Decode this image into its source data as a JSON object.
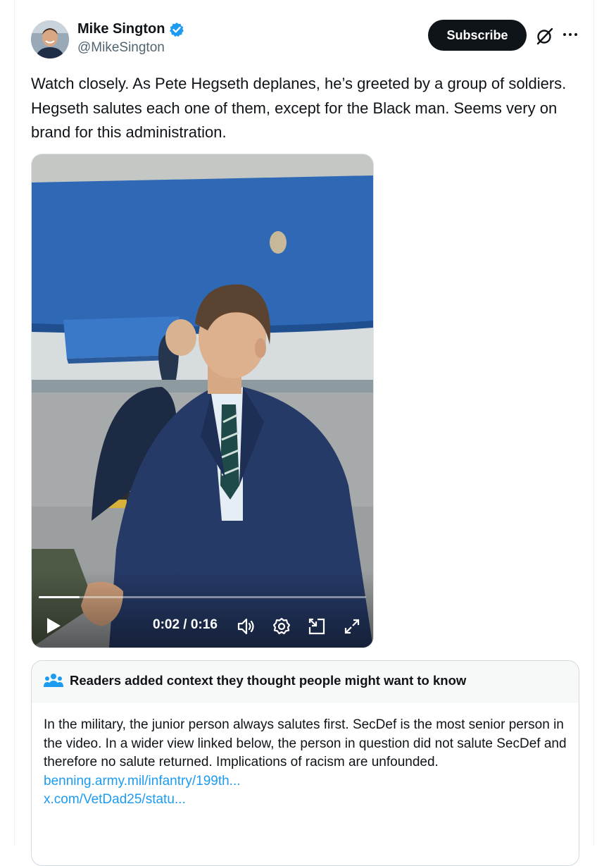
{
  "author": {
    "name": "Mike Sington",
    "handle": "@MikeSington",
    "verified": true,
    "verified_color": "#1d9bf0"
  },
  "actions": {
    "subscribe_label": "Subscribe",
    "grok_icon": "grok-icon",
    "more_icon": "more-horizontal-icon"
  },
  "tweet": {
    "text": "Watch closely. As Pete Hegseth deplanes, he’s greeted by a group of soldiers. Hegseth salutes each one of them, except for the Black man. Seems very on brand for this administration."
  },
  "video": {
    "current_time": "0:02",
    "duration": "0:16",
    "time_display": "0:02 / 0:16",
    "progress": 0.125,
    "controls": [
      "play-icon",
      "volume-icon",
      "settings-icon",
      "picture-in-picture-icon",
      "fullscreen-icon"
    ]
  },
  "community_note": {
    "title": "Readers added context they thought people might want to know",
    "body": "In the military, the junior person always salutes first. SecDef is the most senior person in the video. In a wider view linked below, the person in question did not salute SecDef and therefore no salute returned. Implications of racism are unfounded.",
    "links": [
      "benning.army.mil/infantry/199th...",
      "x.com/VetDad25/statu..."
    ]
  },
  "colors": {
    "accent": "#1d9bf0",
    "text": "#0f1419",
    "muted": "#536471",
    "note_header_bg": "#f7f9f9"
  }
}
